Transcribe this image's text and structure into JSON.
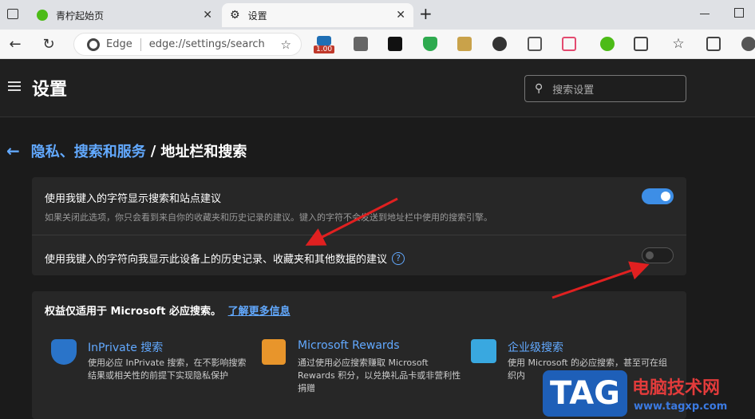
{
  "browser": {
    "tabs": [
      {
        "label": "青柠起始页"
      },
      {
        "label": "设置"
      }
    ],
    "new_tab_glyph": "+",
    "close_glyph": "✕",
    "omnibox": {
      "brand": "Edge",
      "url": "edge://settings/search"
    },
    "extension_badge": "1.00"
  },
  "settings": {
    "title": "设置",
    "search_placeholder": "搜索设置",
    "breadcrumb": {
      "parent": "隐私、搜索和服务",
      "sep": "/",
      "current": "地址栏和搜索"
    },
    "rows": [
      {
        "title": "使用我键入的字符显示搜索和站点建议",
        "desc": "如果关闭此选项，你只会看到来自你的收藏夹和历史记录的建议。键入的字符不会发送到地址栏中使用的搜索引擎。",
        "enabled": true
      },
      {
        "title": "使用我键入的字符向我显示此设备上的历史记录、收藏夹和其他数据的建议",
        "info": "?",
        "enabled": false
      }
    ],
    "benefits": {
      "heading": "权益仅适用于 Microsoft 必应搜索。",
      "learn_more": "了解更多信息",
      "items": [
        {
          "title": "InPrivate 搜索",
          "desc": "使用必应 InPrivate 搜索，在不影响搜索结果或相关性的前提下实现隐私保护"
        },
        {
          "title": "Microsoft Rewards",
          "desc": "通过使用必应搜索赚取 Microsoft Rewards 积分，以兑换礼品卡或非营利性捐赠"
        },
        {
          "title": "企业级搜索",
          "desc": "使用 Microsoft 的必应搜索，甚至可在组织内"
        }
      ]
    }
  },
  "watermark": {
    "tag": "TAG",
    "cn": "电脑技术网",
    "url": "www.tagxp.com"
  },
  "colors": {
    "accent": "#62a9ff",
    "toggle_on": "#3d8ee6",
    "annotation": "#e02020"
  }
}
